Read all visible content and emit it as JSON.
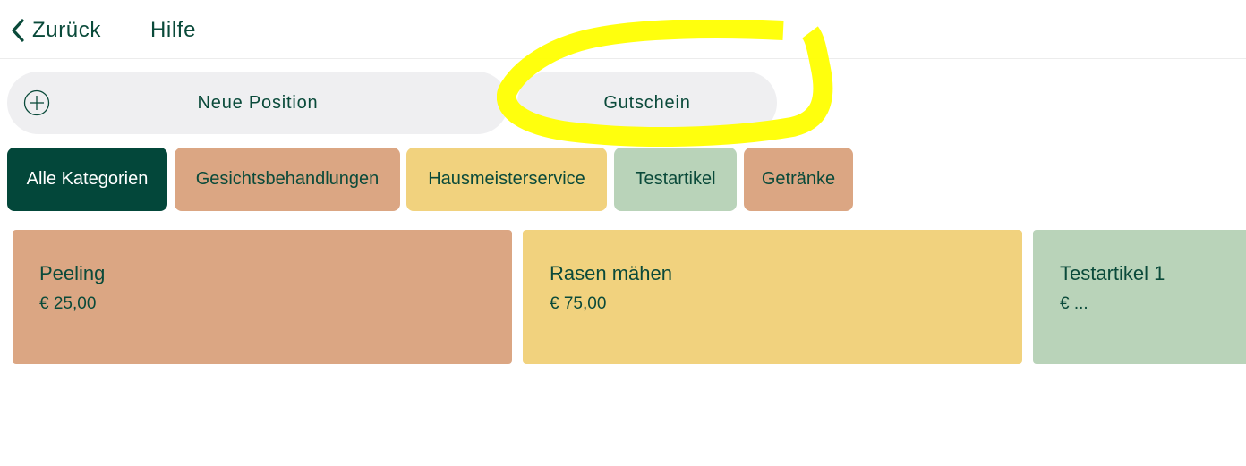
{
  "topbar": {
    "back_label": "Zurück",
    "help_label": "Hilfe"
  },
  "actions": {
    "new_position_label": "Neue Position",
    "voucher_label": "Gutschein"
  },
  "categories": [
    {
      "label": "Alle Kategorien",
      "color": "#03473a",
      "active": true
    },
    {
      "label": "Gesichtsbehandlungen",
      "color": "#dba683"
    },
    {
      "label": "Hausmeisterservice",
      "color": "#f1d27e"
    },
    {
      "label": "Testartikel",
      "color": "#b9d3b9"
    },
    {
      "label": "Getränke",
      "color": "#dba683"
    }
  ],
  "products": [
    {
      "name": "Peeling",
      "price": "€ 25,00",
      "color": "#dba683"
    },
    {
      "name": "Rasen mähen",
      "price": "€ 75,00",
      "color": "#f1d27e"
    },
    {
      "name": "Testartikel 1",
      "price": "€ ...",
      "color": "#b9d3b9"
    }
  ],
  "colors": {
    "text": "#0a4a3a",
    "highlight": "#ffff00",
    "button_bg": "#efeff1"
  }
}
